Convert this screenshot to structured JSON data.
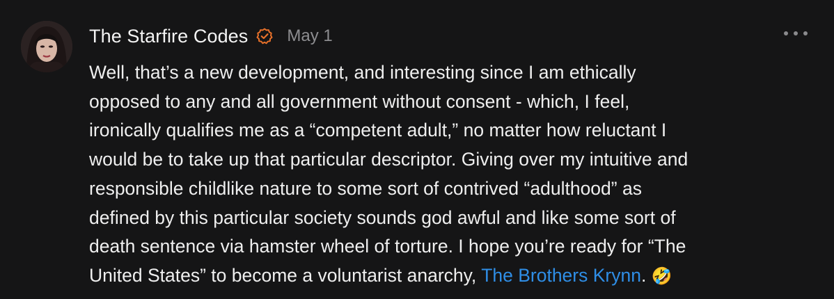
{
  "comment": {
    "author": "The Starfire Codes",
    "date": "May 1",
    "body_lines": [
      "Well, that’s a new development, and interesting since I am ethically",
      "opposed to any and all government without consent - which, I feel,",
      "ironically qualifies me as a “competent adult,” no matter how reluctant I",
      "would be to take up that particular descriptor. Giving over my intuitive and",
      "responsible childlike nature to some sort of contrived “adulthood” as",
      "defined by this particular society sounds god awful and like some sort of",
      "death sentence via hamster wheel of torture. I hope you’re ready for “The"
    ],
    "last_line_before": "United States” to become a voluntarist anarchy, ",
    "mention": "The Brothers Krynn",
    "last_line_after": ". ",
    "emoji": "🤣"
  },
  "icons": {
    "verified": "verified-check-icon",
    "more": "more-options-icon"
  },
  "colors": {
    "background": "#151516",
    "text": "#efefef",
    "muted": "#8d8d90",
    "mention": "#2f8ee6",
    "verified": "#e8712a"
  }
}
